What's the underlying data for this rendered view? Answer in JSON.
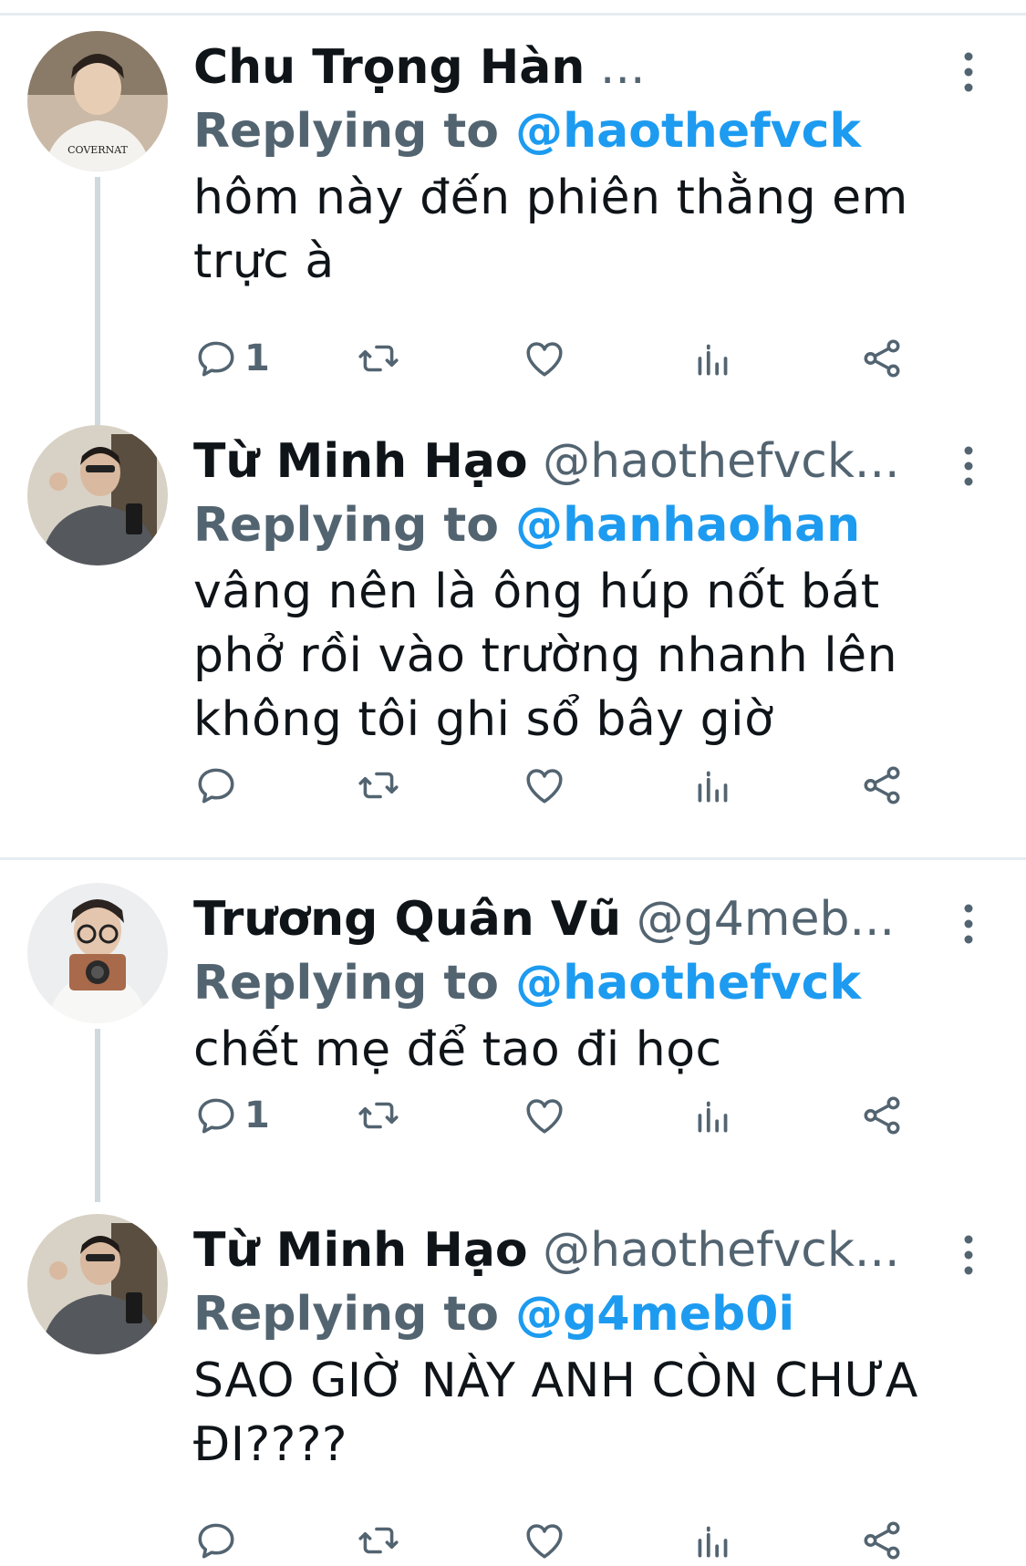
{
  "tweets": [
    {
      "name": "Chu Trọng Hàn",
      "handle": " ...",
      "replying_label": "Replying to ",
      "replying_to": "@haothefvck",
      "lines": [
        "hôm này đến phiên thằng em",
        "trực à"
      ],
      "reply_count": "1"
    },
    {
      "name": "Từ Minh Hạo",
      "handle": " @haothefvck...",
      "replying_label": "Replying to ",
      "replying_to": "@hanhaohan",
      "lines": [
        "vâng nên là ông húp nốt bát",
        "phở rồi vào trường nhanh lên",
        "không tôi ghi sổ bây giờ"
      ],
      "reply_count": ""
    },
    {
      "name": "Trương Quân Vũ",
      "handle": " @g4meb...",
      "replying_label": "Replying to ",
      "replying_to": "@haothefvck",
      "lines": [
        "chết mẹ để tao đi học"
      ],
      "reply_count": "1"
    },
    {
      "name": "Từ Minh Hạo",
      "handle": " @haothefvck...",
      "replying_label": "Replying to ",
      "replying_to": "@g4meb0i",
      "lines": [
        "SAO GIỜ NÀY ANH CÒN CHƯA",
        "ĐI????"
      ],
      "reply_count": ""
    }
  ],
  "icons": [
    "reply-icon",
    "retweet-icon",
    "like-icon",
    "analytics-icon",
    "share-icon",
    "more-options-icon"
  ],
  "colors": {
    "text": "#0f1419",
    "secondary": "#536471",
    "link": "#1d9bf0",
    "divider": "#e6ecf0",
    "thread_line": "#cfd9de"
  }
}
